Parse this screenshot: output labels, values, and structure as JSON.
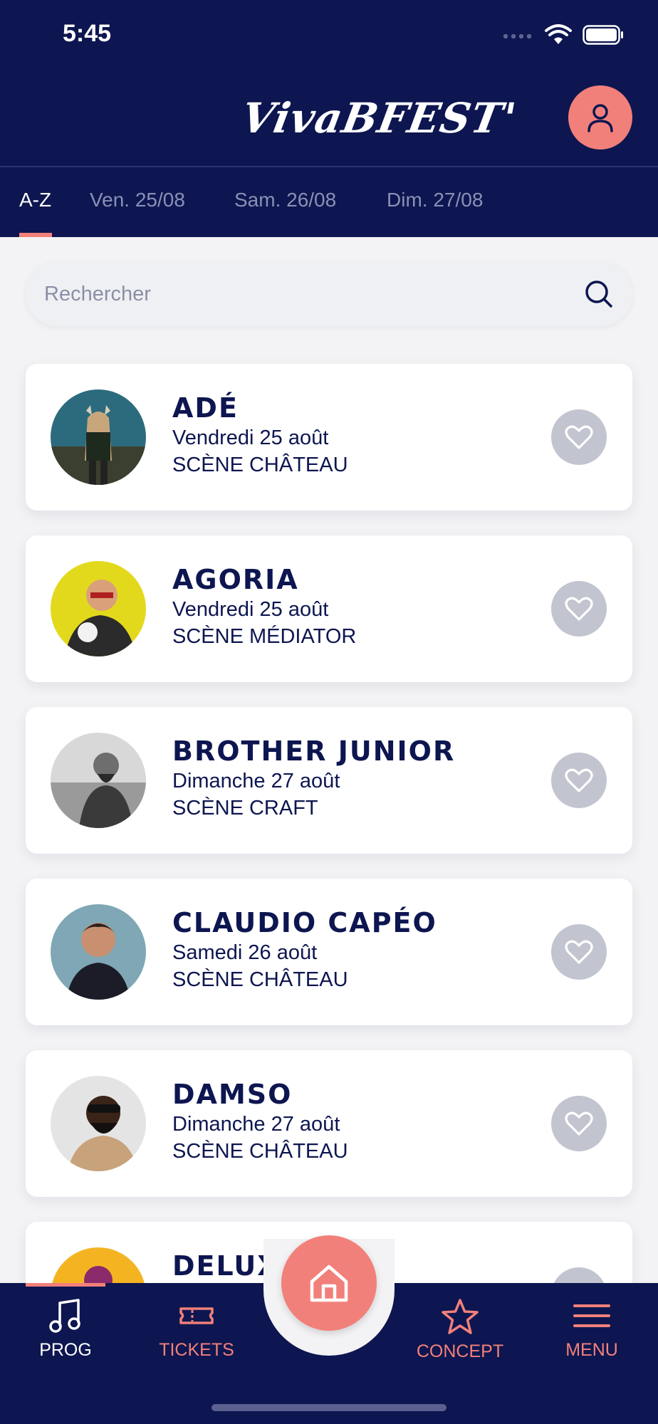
{
  "status_bar": {
    "time": "5:45"
  },
  "app": {
    "logo_text": "VivaBFEST'"
  },
  "tabs": [
    {
      "label": "A-Z",
      "active": true
    },
    {
      "label": "Ven. 25/08",
      "active": false
    },
    {
      "label": "Sam. 26/08",
      "active": false
    },
    {
      "label": "Dim. 27/08",
      "active": false
    }
  ],
  "search": {
    "placeholder": "Rechercher"
  },
  "artists": [
    {
      "name": "ADÉ",
      "day": "Vendredi 25 août",
      "stage": "SCÈNE CHÂTEAU"
    },
    {
      "name": "AGORIA",
      "day": "Vendredi 25 août",
      "stage": "SCÈNE MÉDIATOR"
    },
    {
      "name": "BROTHER JUNIOR",
      "day": "Dimanche 27 août",
      "stage": "SCÈNE CRAFT"
    },
    {
      "name": "CLAUDIO CAPÉO",
      "day": "Samedi 26 août",
      "stage": "SCÈNE CHÂTEAU"
    },
    {
      "name": "DAMSO",
      "day": "Dimanche 27 août",
      "stage": "SCÈNE CHÂTEAU"
    },
    {
      "name": "DELUXE",
      "day": "",
      "stage": ""
    }
  ],
  "bottom_nav": {
    "items": [
      {
        "label": "PROG",
        "icon": "music-note-icon",
        "active": true
      },
      {
        "label": "TICKETS",
        "icon": "ticket-icon",
        "active": false
      },
      {
        "label": "CONCEPT",
        "icon": "star-icon",
        "active": false
      },
      {
        "label": "MENU",
        "icon": "menu-icon",
        "active": false
      }
    ],
    "home_icon": "home-icon"
  },
  "colors": {
    "navy": "#0d1650",
    "coral": "#f2807a",
    "fav_gray": "#c2c4d0"
  }
}
